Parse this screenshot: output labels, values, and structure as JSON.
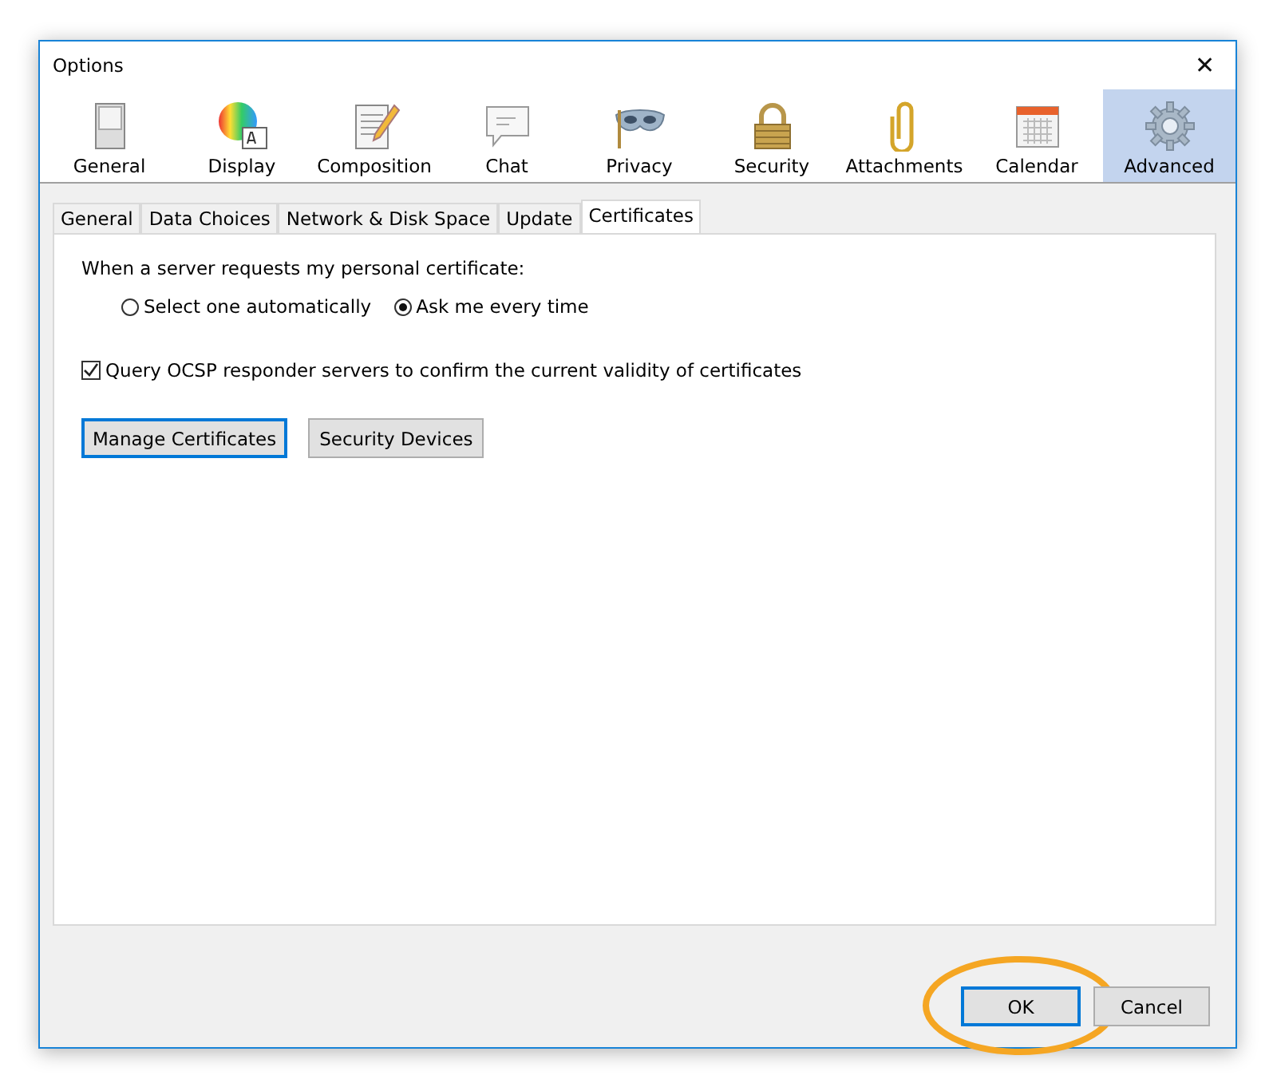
{
  "window": {
    "title": "Options",
    "close": "✕"
  },
  "categories": [
    {
      "label": "General",
      "selected": false
    },
    {
      "label": "Display",
      "selected": false
    },
    {
      "label": "Composition",
      "selected": false
    },
    {
      "label": "Chat",
      "selected": false
    },
    {
      "label": "Privacy",
      "selected": false
    },
    {
      "label": "Security",
      "selected": false
    },
    {
      "label": "Attachments",
      "selected": false
    },
    {
      "label": "Calendar",
      "selected": false
    },
    {
      "label": "Advanced",
      "selected": true
    }
  ],
  "tabs": [
    {
      "label": "General",
      "selected": false
    },
    {
      "label": "Data Choices",
      "selected": false
    },
    {
      "label": "Network & Disk Space",
      "selected": false
    },
    {
      "label": "Update",
      "selected": false
    },
    {
      "label": "Certificates",
      "selected": true
    }
  ],
  "certificate_prompt": {
    "label": "When a server requests my personal certificate:",
    "options": [
      {
        "label": "Select one automatically",
        "selected": false
      },
      {
        "label": "Ask me every time",
        "selected": true
      }
    ]
  },
  "ocsp": {
    "label": "Query OCSP responder servers to confirm the current validity of certificates",
    "checked": true
  },
  "panel_buttons": [
    {
      "label": "Manage Certificates",
      "focused": true
    },
    {
      "label": "Security Devices",
      "focused": false
    }
  ],
  "dialog_buttons": [
    {
      "label": "OK",
      "focused": true,
      "highlighted": true
    },
    {
      "label": "Cancel",
      "focused": false,
      "highlighted": false
    }
  ]
}
